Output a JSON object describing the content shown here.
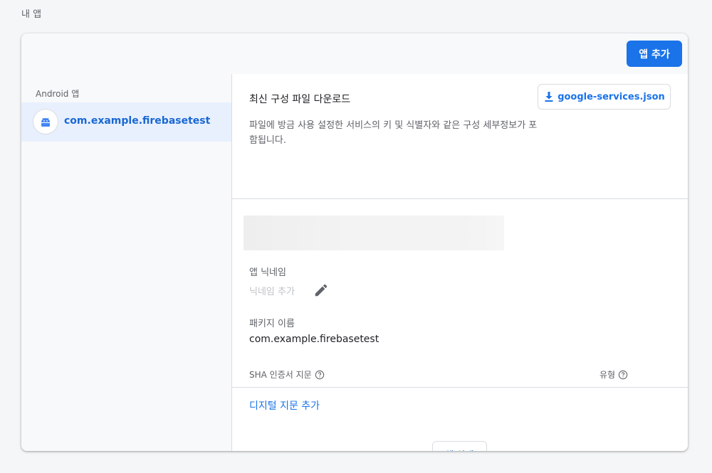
{
  "page": {
    "section_title": "내 앱"
  },
  "header": {
    "add_app_label": "앱 추가"
  },
  "sidebar": {
    "heading": "Android 앱",
    "items": [
      {
        "label": "com.example.firebasetest",
        "icon": "android-icon"
      }
    ]
  },
  "download": {
    "title": "최신 구성 파일 다운로드",
    "description": "파일에 방금 사용 설정한 서비스의 키 및 식별자와 같은 구성 세부정보가 포함됩니다.",
    "button_label": "google-services.json",
    "button_icon": "download-icon"
  },
  "details": {
    "nickname_label": "앱 닉네임",
    "nickname_placeholder": "닉네임 추가",
    "package_label": "패키지 이름",
    "package_value": "com.example.firebasetest"
  },
  "fingerprints": {
    "sha_header": "SHA 인증서 지문",
    "type_header": "유형",
    "add_link": "디지털 지문 추가"
  },
  "footer": {
    "delete_label": "앱 삭제"
  },
  "colors": {
    "accent": "#1a73e8",
    "selected_bg": "#e8f0fe"
  }
}
